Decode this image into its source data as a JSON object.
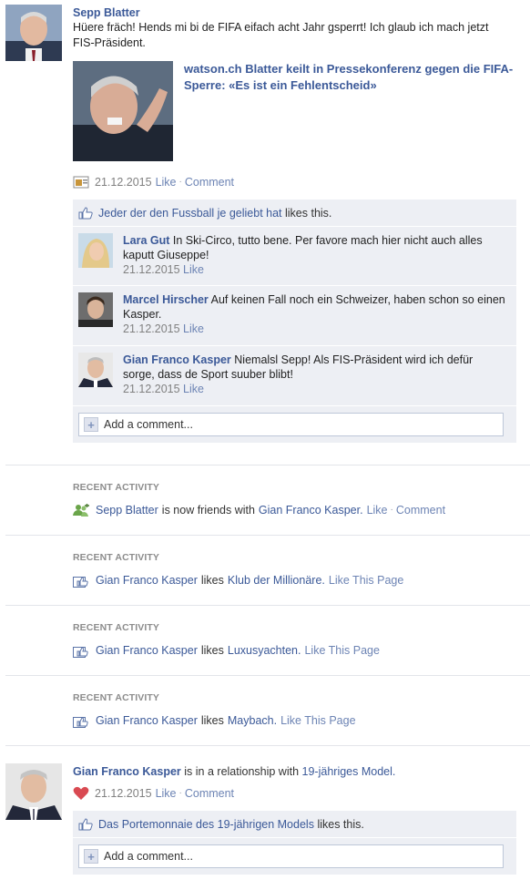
{
  "post1": {
    "author": "Sepp Blatter",
    "text": "Hüere fräch! Hends mi bi de FIFA eifach acht Jahr gsperrt! Ich glaub ich mach jetzt FIS-Präsident.",
    "attachment": {
      "source": "watson.ch",
      "title": "Blatter keilt in Pressekonferenz gegen die FIFA-Sperre: «Es ist ein Fehlentscheid»"
    },
    "timestamp": "21.12.2015",
    "like_label": "Like",
    "comment_label": "Comment",
    "likers": "Jeder der den Fussball je geliebt hat",
    "likes_suffix": "likes this.",
    "comments": [
      {
        "author": "Lara Gut",
        "text": "In Ski-Circo, tutto bene. Per favore mach hier nicht auch alles kaputt Giuseppe!",
        "timestamp": "21.12.2015",
        "like_label": "Like"
      },
      {
        "author": "Marcel Hirscher",
        "text": "Auf keinen Fall noch ein Schweizer, haben schon so einen Kasper.",
        "timestamp": "21.12.2015",
        "like_label": "Like"
      },
      {
        "author": "Gian Franco Kasper",
        "text": "Niemalsl Sepp! Als FIS-Präsident wird ich defür sorge, dass de Sport suuber blibt!",
        "timestamp": "21.12.2015",
        "like_label": "Like"
      }
    ],
    "add_comment_placeholder": "Add a comment..."
  },
  "activities": [
    {
      "label": "RECENT ACTIVITY",
      "icon": "friends-icon",
      "subject": "Sepp Blatter",
      "verb": "is now friends with",
      "object": "Gian Franco Kasper.",
      "action1": "Like",
      "action2": "Comment"
    },
    {
      "label": "RECENT ACTIVITY",
      "icon": "like-page-icon",
      "subject": "Gian Franco Kasper",
      "verb": "likes",
      "object": "Klub der Millionäre.",
      "action1": "Like This Page"
    },
    {
      "label": "RECENT ACTIVITY",
      "icon": "like-page-icon",
      "subject": "Gian Franco Kasper",
      "verb": "likes",
      "object": "Luxusyachten.",
      "action1": "Like This Page"
    },
    {
      "label": "RECENT ACTIVITY",
      "icon": "like-page-icon",
      "subject": "Gian Franco Kasper",
      "verb": "likes",
      "object": "Maybach.",
      "action1": "Like This Page"
    }
  ],
  "post2": {
    "author": "Gian Franco Kasper",
    "verb": "is in a relationship with",
    "partner": "19-jähriges Model.",
    "timestamp": "21.12.2015",
    "like_label": "Like",
    "comment_label": "Comment",
    "likers": "Das Portemonnaie des 19-jährigen Models",
    "likes_suffix": "likes this.",
    "add_comment_placeholder": "Add a comment..."
  },
  "colors": {
    "link": "#3b5998",
    "ufi_bg": "#edeff4",
    "heart": "#d94a52"
  }
}
